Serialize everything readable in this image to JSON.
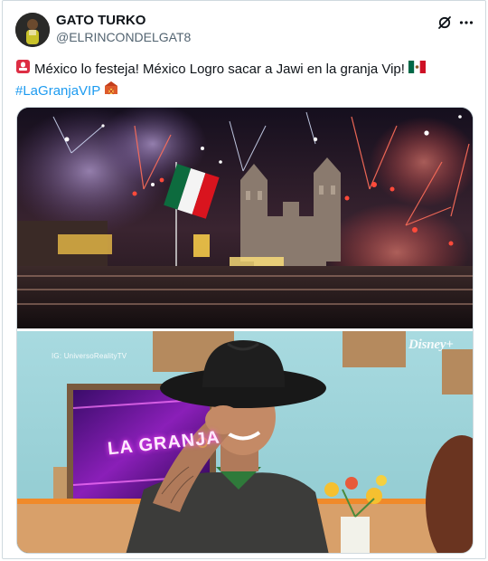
{
  "author": {
    "name": "GATO TURKO",
    "handle": "@ELRINCONDELGAT8",
    "avatar_icon": "user-avatar"
  },
  "actions": {
    "grok_icon": "grok-icon",
    "more_icon": "more-horizontal-icon"
  },
  "tweet": {
    "line1_emoji": "police-siren-emoji",
    "line1_text": "México lo festeja! México Logro sacar a Jawi en la granja Vip!",
    "line1_flag": "mexico-flag-emoji",
    "hashtag": "#LaGranjaVIP",
    "hashtag_emoji": "barn-emoji"
  },
  "media": {
    "photo1_alt": "zocalo-fireworks-photo",
    "photo2_alt": "man-cowboy-hat-pointing-photo",
    "watermark_ig": "IG: UniversoRealityTV",
    "watermark_brand": "Disney+",
    "tv_screen_text": "LA GRANJA"
  },
  "colors": {
    "link": "#1d9bf0",
    "secondary_text": "#536471",
    "border": "#cfd9de"
  }
}
